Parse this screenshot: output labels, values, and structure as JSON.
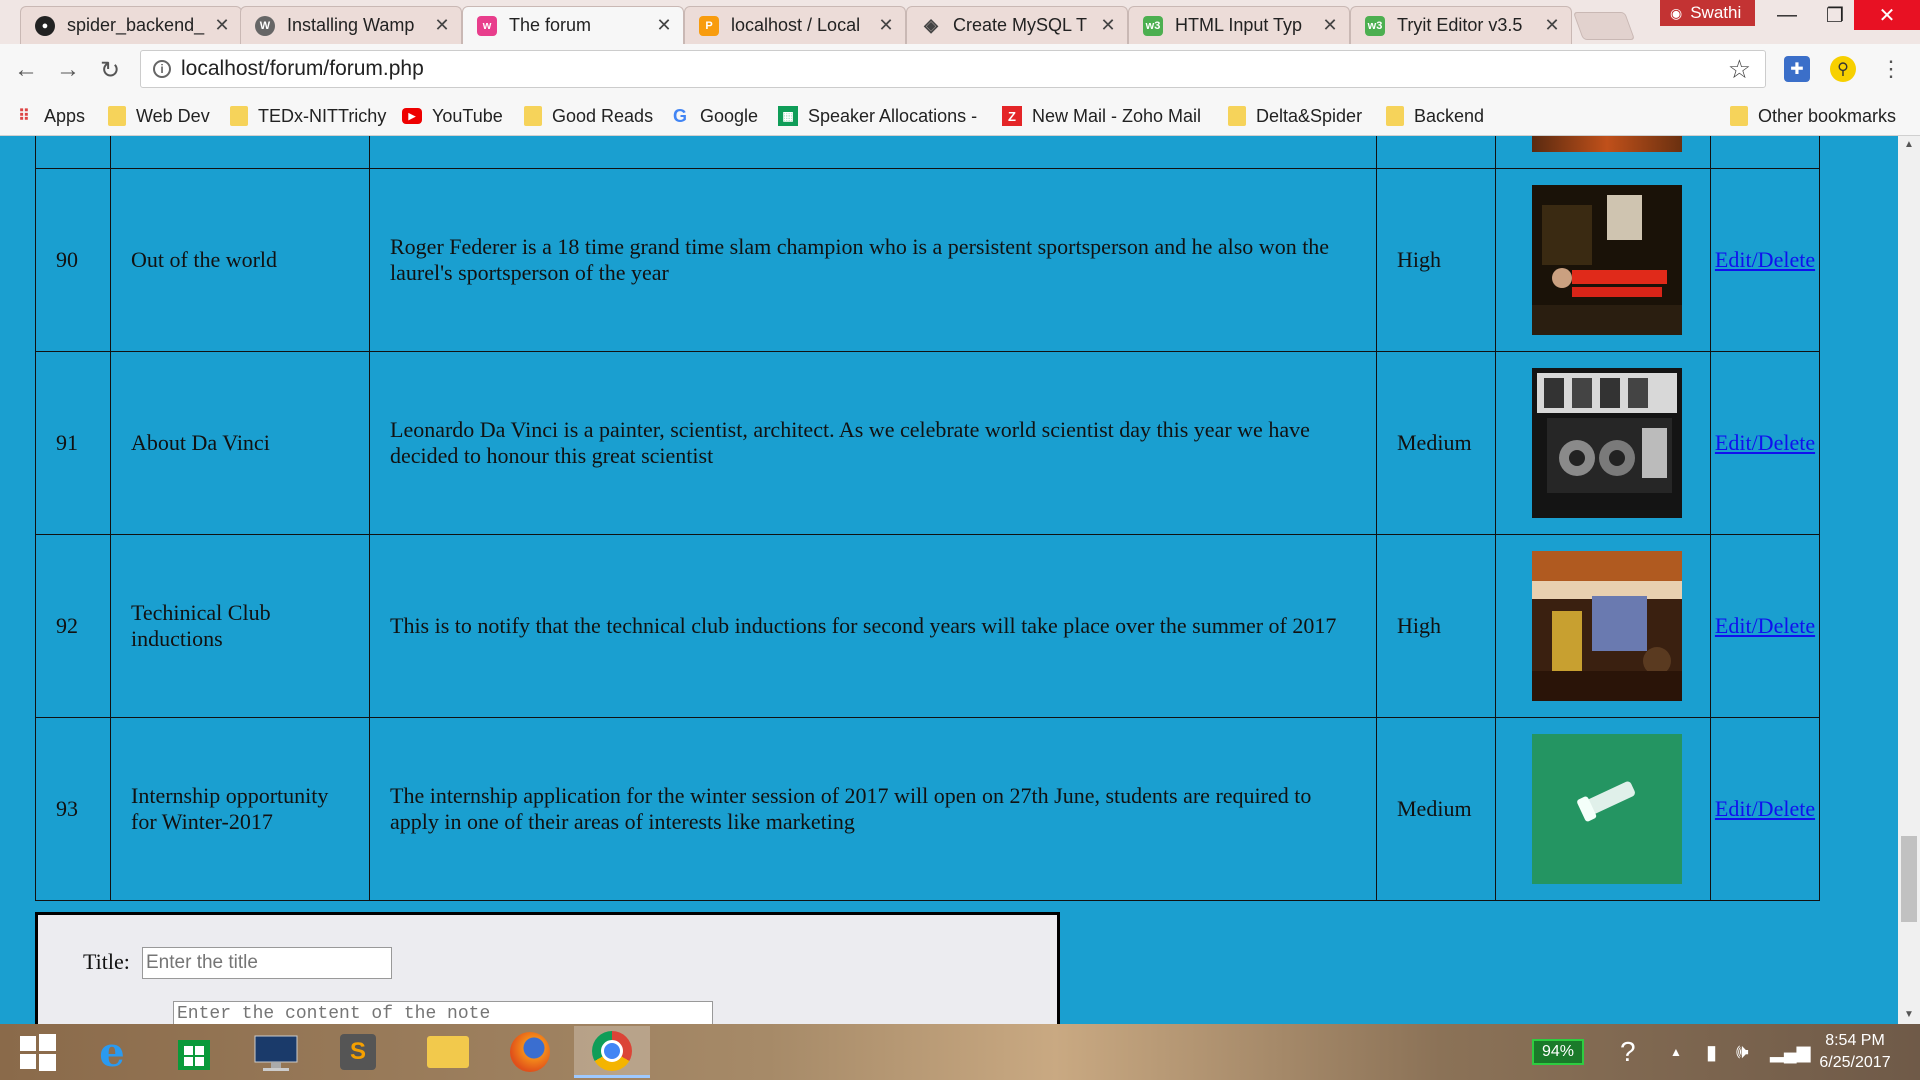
{
  "browser": {
    "tabs": [
      {
        "label": "spider_backend_",
        "icon": "github-icon",
        "icon_color": "#222222",
        "active": false
      },
      {
        "label": "Installing Wamp",
        "icon": "wordpress-icon",
        "icon_color": "#555555",
        "active": false
      },
      {
        "label": "The forum",
        "icon": "forum-icon",
        "icon_color": "#e83e8c",
        "active": true
      },
      {
        "label": "localhost / Local",
        "icon": "phpmyadmin-icon",
        "icon_color": "#f89c0e",
        "active": false
      },
      {
        "label": "Create MySQL T",
        "icon": "diamond-icon",
        "icon_color": "#555555",
        "active": false
      },
      {
        "label": "HTML Input Typ",
        "icon": "w3schools-icon",
        "icon_color": "#4caf50",
        "active": false
      },
      {
        "label": "Tryit Editor v3.5",
        "icon": "w3schools-icon",
        "icon_color": "#4caf50",
        "active": false
      }
    ],
    "user": "Swathi",
    "url": "localhost/forum/forum.php",
    "bookmarks": [
      {
        "label": "Apps",
        "icon": "apps-grid-icon"
      },
      {
        "label": "Web Dev",
        "icon": "folder-icon"
      },
      {
        "label": "TEDx-NITTrichy",
        "icon": "folder-icon"
      },
      {
        "label": "YouTube",
        "icon": "youtube-icon"
      },
      {
        "label": "Good Reads",
        "icon": "folder-icon"
      },
      {
        "label": "Google",
        "icon": "google-icon"
      },
      {
        "label": "Speaker Allocations -",
        "icon": "sheets-icon"
      },
      {
        "label": "New Mail - Zoho Mail",
        "icon": "zoho-icon"
      },
      {
        "label": "Delta&Spider",
        "icon": "folder-icon"
      },
      {
        "label": "Backend",
        "icon": "folder-icon"
      },
      {
        "label": "Other bookmarks",
        "icon": "folder-icon"
      }
    ]
  },
  "notes": [
    {
      "id": "",
      "title": "",
      "content": "",
      "priority": "",
      "image": "thumb-partial",
      "action": ""
    },
    {
      "id": "90",
      "title": "Out of the world",
      "content": "Roger Federer is a 18 time grand time slam champion who is a persistent sportsperson and he also won the laurel's sportsperson of the year",
      "priority": "High",
      "image": "thumb-event",
      "action": "Edit/Delete"
    },
    {
      "id": "91",
      "title": "About Da Vinci",
      "content": "Leonardo Da Vinci is a painter, scientist, architect. As we celebrate world scientist day this year we have decided to honour this great scientist",
      "priority": "Medium",
      "image": "thumb-xray",
      "action": "Edit/Delete"
    },
    {
      "id": "92",
      "title": "Techinical Club inductions",
      "content": "This is to notify that the technical club inductions for second years will take place over the summer of 2017",
      "priority": "High",
      "image": "thumb-people",
      "action": "Edit/Delete"
    },
    {
      "id": "93",
      "title": "Internship opportunity for Winter-2017",
      "content": "The internship application for the winter session of 2017 will open on 27th June, students are required to apply in one of their areas of interests like marketing",
      "priority": "Medium",
      "image": "thumb-green",
      "action": "Edit/Delete"
    }
  ],
  "form": {
    "title_label": "Title:",
    "title_placeholder": "Enter the title",
    "content_placeholder": "Enter the content of the note"
  },
  "taskbar": {
    "battery": "94%",
    "time": "8:54 PM",
    "date": "6/25/2017"
  },
  "colors": {
    "page_background": "#1a9fd0",
    "link": "#1010ee",
    "active_tab_icon": "#e83e8c"
  }
}
